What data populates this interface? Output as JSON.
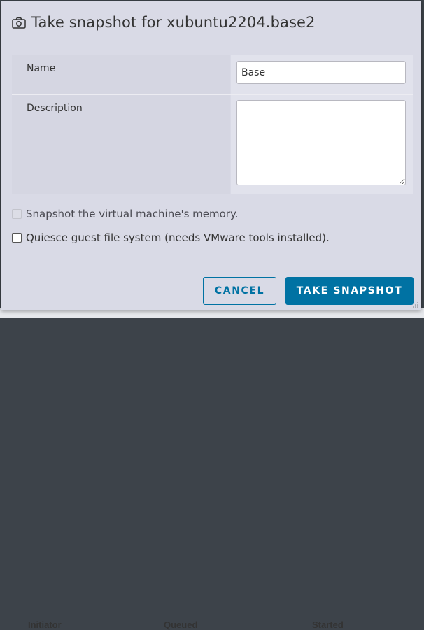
{
  "dialog": {
    "title": "Take snapshot for xubuntu2204.base2",
    "icon": "camera-icon"
  },
  "form": {
    "name_label": "Name",
    "name_value": "Base",
    "description_label": "Description",
    "description_value": ""
  },
  "options": {
    "memory_label": "Snapshot the virtual machine's memory.",
    "memory_checked": false,
    "memory_disabled": true,
    "quiesce_label": "Quiesce guest file system (needs VMware tools installed).",
    "quiesce_checked": false
  },
  "actions": {
    "cancel_label": "CANCEL",
    "submit_label": "TAKE SNAPSHOT"
  },
  "background": {
    "col1": "Initiator",
    "col2": "Queued",
    "col3": "Started"
  },
  "colors": {
    "primary": "#0072a3",
    "dialog_bg": "#d9dae6"
  }
}
